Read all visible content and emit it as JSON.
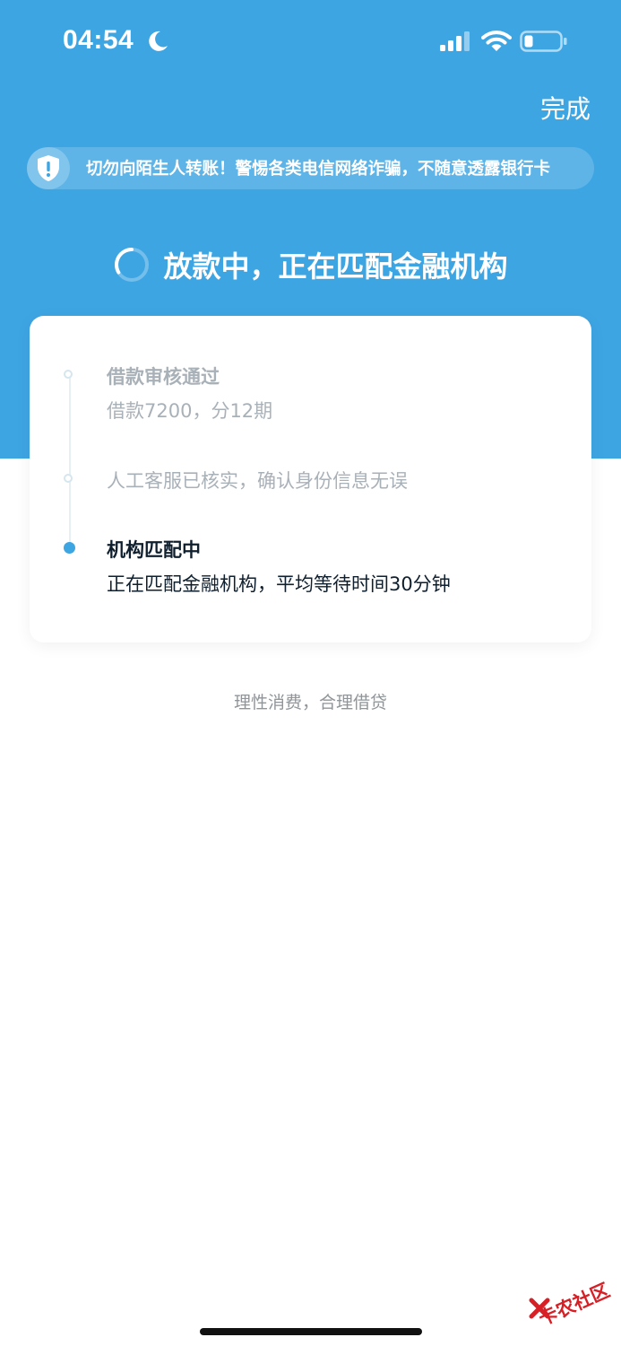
{
  "status_bar": {
    "time": "04:54",
    "moon_icon": "moon-icon",
    "signal_icon": "cellular-signal-icon",
    "wifi_icon": "wifi-icon",
    "battery_icon": "battery-icon"
  },
  "header": {
    "done_label": "完成",
    "warning": "切勿向陌生人转账！警惕各类电信网络诈骗，不随意透露银行卡",
    "status_title": "放款中，正在匹配金融机构"
  },
  "timeline": {
    "steps": [
      {
        "title": "借款审核通过",
        "desc": "借款7200，分12期",
        "state": "done"
      },
      {
        "title": "人工客服已核实，确认身份信息无误",
        "state": "done"
      },
      {
        "title": "机构匹配中",
        "desc": "正在匹配金融机构，平均等待时间30分钟",
        "state": "active"
      }
    ]
  },
  "footer": {
    "slogan": "理性消费，合理借贷"
  },
  "watermark": {
    "text": "卡农社区"
  },
  "colors": {
    "brand_blue": "#3ea5e3",
    "muted_text": "#a9b1b8",
    "dark_text": "#0f1f2e"
  }
}
